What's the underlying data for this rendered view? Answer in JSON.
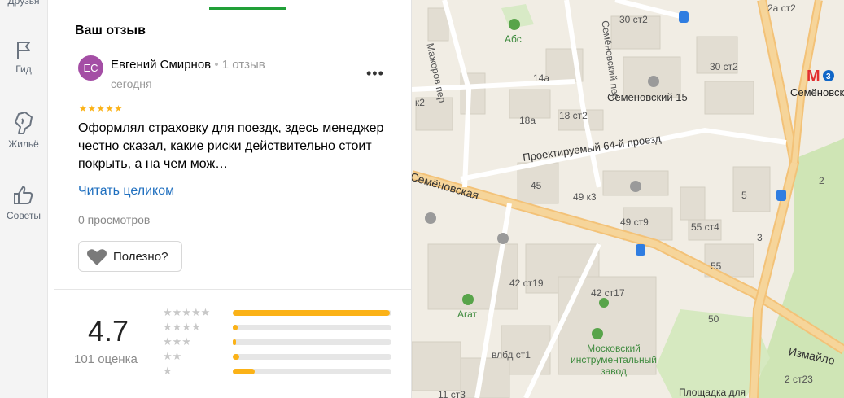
{
  "rail": {
    "items": [
      {
        "label": "Друзья"
      },
      {
        "label": "Гид"
      },
      {
        "label": "Жильё"
      },
      {
        "label": "Советы"
      }
    ]
  },
  "review": {
    "section_title": "Ваш отзыв",
    "avatar_initials": "ЕС",
    "avatar_color": "#a44ea5",
    "author": "Евгений Смирнов",
    "author_reviews": "1 отзыв",
    "date": "сегодня",
    "stars": "★★★★★",
    "text": "Оформлял страховку для поездк, здесь менеджер честно сказал, какие риски действительно стоит покрыть, а на чем мож…",
    "read_more": "Читать целиком",
    "views": "0 просмотров",
    "useful": "Полезно?"
  },
  "summary": {
    "rating": "4.7",
    "count": "101 оценка",
    "breakdown": [
      {
        "stars": "★★★★★",
        "fraction": 0.99
      },
      {
        "stars": "★★★★",
        "fraction": 0.03
      },
      {
        "stars": "★★★",
        "fraction": 0.02
      },
      {
        "stars": "★★",
        "fraction": 0.04
      },
      {
        "stars": "★",
        "fraction": 0.14
      }
    ]
  },
  "map": {
    "labels": {
      "druzhba": "Мажоров пер",
      "abs": "Абс",
      "semenovsky_per": "Семёновский пер",
      "b30": "30 ст2",
      "b2a": "2а ст2",
      "metro": "Семёновская",
      "metro_line": "3",
      "sem15": "Семёновский 15",
      "b14a": "14а",
      "b30_2": "30 ст2",
      "b18a": "18а",
      "b18": "18 ст2",
      "k2": "к2",
      "proezd": "Проектируемый 64-й проезд",
      "street": "Б. Семёновская",
      "b45": "45",
      "b49k3": "49 к3",
      "b5": "5",
      "b49st9": "49 ст9",
      "b55": "55 ст4",
      "b55b": "55",
      "b3": "3",
      "b2": "2",
      "b42": "42 ст19",
      "agat": "Агат",
      "b42st17": "42 ст17",
      "mik": "Московский инструментальный завод",
      "b50": "50",
      "vlbd": "влбд ст1",
      "izm": "Измайло",
      "b2st23": "2 ст23",
      "b11": "11 ст3",
      "ploshad": "Площадка для"
    }
  }
}
